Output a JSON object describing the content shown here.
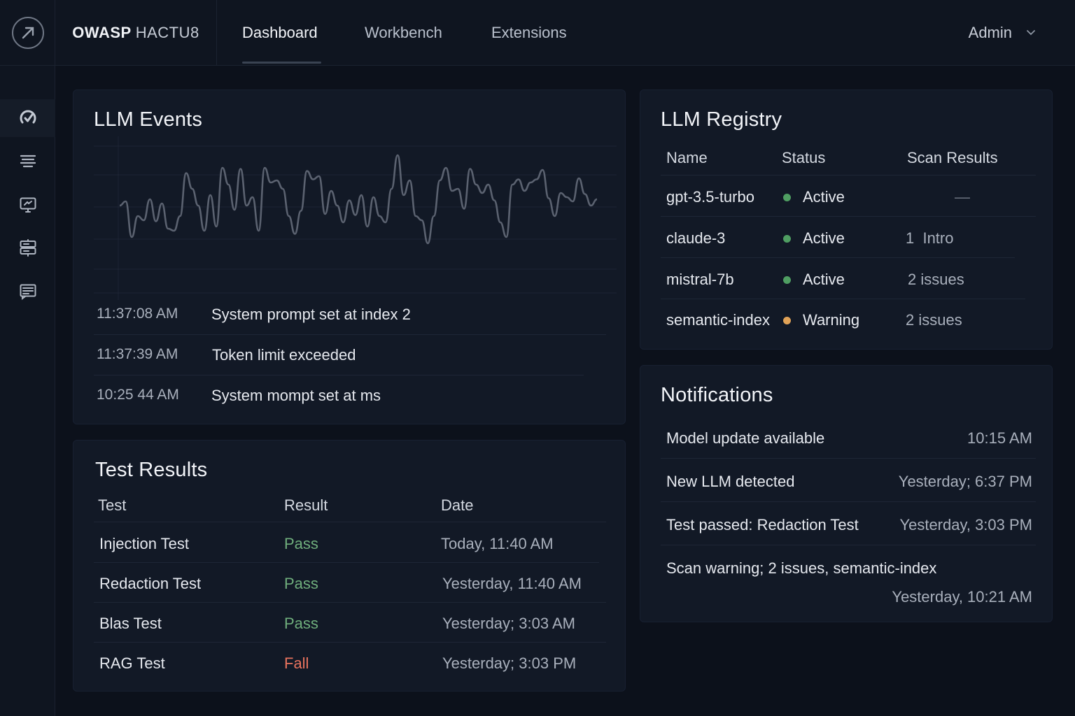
{
  "app": {
    "brand_bold": "OWASP",
    "brand_light": "HACTU8"
  },
  "nav": {
    "tabs": [
      {
        "label": "Dashboard",
        "active": true
      },
      {
        "label": "Workbench"
      },
      {
        "label": "Extensions"
      }
    ],
    "user": "Admin"
  },
  "sidebar": {
    "items": [
      {
        "icon": "gauge-icon",
        "active": true
      },
      {
        "icon": "list-icon"
      },
      {
        "icon": "monitor-icon"
      },
      {
        "icon": "server-icon"
      },
      {
        "icon": "message-icon"
      }
    ]
  },
  "events": {
    "title": "LLM Events",
    "rows": [
      {
        "time": "11:37:08 AM",
        "text": "System prompt set at index 2"
      },
      {
        "time": "11:37:39 AM",
        "text": "Token limit exceeded"
      },
      {
        "time": "10:25 44 AM",
        "text": "System mompt set at ms"
      }
    ]
  },
  "chart_data": {
    "type": "line",
    "title": "",
    "xlabel": "",
    "ylabel": "",
    "grid": true,
    "series": [
      {
        "values": [
          50,
          54,
          20,
          40,
          36,
          56,
          35,
          52,
          28,
          26,
          40,
          81,
          66,
          50,
          26,
          60,
          30,
          86,
          70,
          46,
          85,
          50,
          58,
          26,
          86,
          72,
          74,
          66,
          40,
          23,
          45,
          83,
          75,
          78,
          42,
          64,
          50,
          34,
          55,
          41,
          60,
          30,
          58,
          40,
          34,
          66,
          98,
          60,
          74,
          40,
          36,
          14,
          40,
          74,
          86,
          64,
          66,
          47,
          85,
          70,
          62,
          70,
          55,
          34,
          20,
          70,
          75,
          64,
          72,
          75,
          84,
          57,
          40,
          62,
          58,
          54,
          76,
          61,
          50,
          56
        ]
      }
    ],
    "color": "#5b6270"
  },
  "registry": {
    "title": "LLM Registry",
    "headers": {
      "name": "Name",
      "status": "Status",
      "scan": "Scan Results"
    },
    "rows": [
      {
        "name": "gpt-3.5-turbo",
        "status": "Active",
        "status_color": "#4f9e62",
        "scan": "—"
      },
      {
        "name": "claude-3",
        "status": "Active",
        "status_color": "#4f9e62",
        "scan": "1  Intro"
      },
      {
        "name": "mistral-7b",
        "status": "Active",
        "status_color": "#4f9e62",
        "scan": "2 issues"
      },
      {
        "name": "semantic-index",
        "status": "Warning",
        "status_color": "#e0a257",
        "scan": "2 issues"
      }
    ]
  },
  "tests": {
    "title": "Test Results",
    "headers": {
      "test": "Test",
      "result": "Result",
      "date": "Date"
    },
    "rows": [
      {
        "test": "Injection Test",
        "result": "Pass",
        "result_color": "#6fae7c",
        "date": "Today, 11:40 AM"
      },
      {
        "test": "Redaction Test",
        "result": "Pass",
        "result_color": "#6fae7c",
        "date": "Yesterday, 11:40 AM"
      },
      {
        "test": "Blas Test",
        "result": "Pass",
        "result_color": "#6fae7c",
        "date": "Yesterday; 3:03 AM"
      },
      {
        "test": "RAG Test",
        "result": "Fall",
        "result_color": "#e8735e",
        "date": "Yesterday; 3:03 PM"
      }
    ]
  },
  "notifications": {
    "title": "Notifications",
    "rows": [
      {
        "text": "Model update available",
        "time": "10:15 AM"
      },
      {
        "text": "New LLM detected",
        "time": "Yesterday; 6:37 PM"
      },
      {
        "text": "Test passed: Redaction Test",
        "time": "Yesterday, 3:03 PM"
      },
      {
        "text": "Scan warning; 2 issues, semantic-index",
        "time": "Yesterday, 10:21 AM"
      }
    ]
  }
}
